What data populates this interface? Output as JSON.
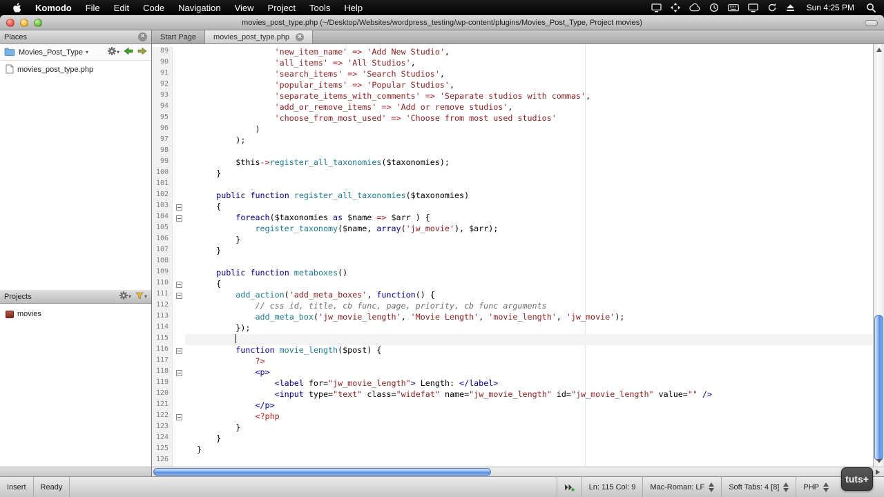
{
  "colors": {
    "pln": "#000000",
    "kw": "#00008b",
    "fn": "#1d7a94",
    "str": "#8f2121",
    "op": "#b02020",
    "com": "#6d6d6d",
    "ln": "#7f7f7f",
    "scrollbar": "#5b8ede"
  },
  "icons": {
    "dropdown": "▾",
    "close": "×"
  },
  "menubar": {
    "app": "Komodo",
    "menus": [
      "File",
      "Edit",
      "Code",
      "Navigation",
      "View",
      "Project",
      "Tools",
      "Help"
    ],
    "status_icons": [
      "screen-sharing",
      "move",
      "cloud",
      "time-machine",
      "keyboard",
      "display",
      "sync",
      "eject"
    ],
    "clock": "Sun 4:25 PM"
  },
  "titlebar": {
    "title": "movies_post_type.php (~/Desktop/Websites/wordpress_testing/wp-content/plugins/Movies_Post_Type, Project movies)"
  },
  "tabs": [
    {
      "label": "Start Page",
      "active": false
    },
    {
      "label": "movies_post_type.php",
      "active": true
    }
  ],
  "places": {
    "title": "Places",
    "folder": "Movies_Post_Type",
    "files": [
      "movies_post_type.php"
    ]
  },
  "projects": {
    "title": "Projects",
    "items": [
      "movies"
    ]
  },
  "statusbar": {
    "mode": "Insert",
    "status": "Ready",
    "position": "Ln: 115 Col: 9",
    "encoding": "Mac-Roman: LF",
    "soft_tabs": "Soft Tabs: 4 [8]",
    "language": "PHP"
  },
  "watermark": {
    "label": "tuts+"
  },
  "editor": {
    "lines": [
      {
        "n": 89,
        "indent": 16,
        "tokens": [
          [
            "str",
            "'new_item_name'"
          ],
          [
            "pln",
            " "
          ],
          [
            "op",
            "=>"
          ],
          [
            "pln",
            " "
          ],
          [
            "str",
            "'Add New Studio'"
          ],
          [
            "pln",
            ","
          ]
        ]
      },
      {
        "n": 90,
        "indent": 16,
        "tokens": [
          [
            "str",
            "'all_items'"
          ],
          [
            "pln",
            " "
          ],
          [
            "op",
            "=>"
          ],
          [
            "pln",
            " "
          ],
          [
            "str",
            "'All Studios'"
          ],
          [
            "pln",
            ","
          ]
        ]
      },
      {
        "n": 91,
        "indent": 16,
        "tokens": [
          [
            "str",
            "'search_items'"
          ],
          [
            "pln",
            " "
          ],
          [
            "op",
            "=>"
          ],
          [
            "pln",
            " "
          ],
          [
            "str",
            "'Search Studios'"
          ],
          [
            "pln",
            ","
          ]
        ]
      },
      {
        "n": 92,
        "indent": 16,
        "tokens": [
          [
            "str",
            "'popular_items'"
          ],
          [
            "pln",
            " "
          ],
          [
            "op",
            "=>"
          ],
          [
            "pln",
            " "
          ],
          [
            "str",
            "'Popular Studios'"
          ],
          [
            "pln",
            ","
          ]
        ]
      },
      {
        "n": 93,
        "indent": 16,
        "tokens": [
          [
            "str",
            "'separate_items_with_comments'"
          ],
          [
            "pln",
            " "
          ],
          [
            "op",
            "=>"
          ],
          [
            "pln",
            " "
          ],
          [
            "str",
            "'Separate studios with commas'"
          ],
          [
            "pln",
            ","
          ]
        ]
      },
      {
        "n": 94,
        "indent": 16,
        "tokens": [
          [
            "str",
            "'add_or_remove_items'"
          ],
          [
            "pln",
            " "
          ],
          [
            "op",
            "=>"
          ],
          [
            "pln",
            " "
          ],
          [
            "str",
            "'Add or remove studios'"
          ],
          [
            "pln",
            ","
          ]
        ]
      },
      {
        "n": 95,
        "indent": 16,
        "tokens": [
          [
            "str",
            "'choose_from_most_used'"
          ],
          [
            "pln",
            " "
          ],
          [
            "op",
            "=>"
          ],
          [
            "pln",
            " "
          ],
          [
            "str",
            "'Choose from most used studios'"
          ]
        ]
      },
      {
        "n": 96,
        "indent": 12,
        "tokens": [
          [
            "pln",
            ")"
          ]
        ]
      },
      {
        "n": 97,
        "indent": 8,
        "tokens": [
          [
            "pln",
            ");"
          ]
        ]
      },
      {
        "n": 98,
        "indent": 0,
        "tokens": []
      },
      {
        "n": 99,
        "indent": 8,
        "tokens": [
          [
            "pln",
            "$this"
          ],
          [
            "op",
            "->"
          ],
          [
            "fn",
            "register_all_taxonomies"
          ],
          [
            "pln",
            "($taxonomies);"
          ]
        ]
      },
      {
        "n": 100,
        "indent": 4,
        "tokens": [
          [
            "pln",
            "}"
          ]
        ]
      },
      {
        "n": 101,
        "indent": 0,
        "tokens": []
      },
      {
        "n": 102,
        "indent": 4,
        "tokens": [
          [
            "kw",
            "public"
          ],
          [
            "pln",
            " "
          ],
          [
            "kw",
            "function"
          ],
          [
            "pln",
            " "
          ],
          [
            "fn",
            "register_all_taxonomies"
          ],
          [
            "pln",
            "($taxonomies)"
          ]
        ]
      },
      {
        "n": 103,
        "indent": 4,
        "fold": true,
        "tokens": [
          [
            "pln",
            "{"
          ]
        ]
      },
      {
        "n": 104,
        "indent": 8,
        "fold": true,
        "tokens": [
          [
            "kw",
            "foreach"
          ],
          [
            "pln",
            "($taxonomies "
          ],
          [
            "kw",
            "as"
          ],
          [
            "pln",
            " $name "
          ],
          [
            "op",
            "=>"
          ],
          [
            "pln",
            " $arr ) {"
          ]
        ]
      },
      {
        "n": 105,
        "indent": 12,
        "tokens": [
          [
            "fn",
            "register_taxonomy"
          ],
          [
            "pln",
            "($name, "
          ],
          [
            "kw",
            "array"
          ],
          [
            "pln",
            "("
          ],
          [
            "str",
            "'jw_movie'"
          ],
          [
            "pln",
            "), $arr);"
          ]
        ]
      },
      {
        "n": 106,
        "indent": 8,
        "tokens": [
          [
            "pln",
            "}"
          ]
        ]
      },
      {
        "n": 107,
        "indent": 4,
        "tokens": [
          [
            "pln",
            "}"
          ]
        ]
      },
      {
        "n": 108,
        "indent": 0,
        "tokens": []
      },
      {
        "n": 109,
        "indent": 4,
        "tokens": [
          [
            "kw",
            "public"
          ],
          [
            "pln",
            " "
          ],
          [
            "kw",
            "function"
          ],
          [
            "pln",
            " "
          ],
          [
            "fn",
            "metaboxes"
          ],
          [
            "pln",
            "()"
          ]
        ]
      },
      {
        "n": 110,
        "indent": 4,
        "fold": true,
        "tokens": [
          [
            "pln",
            "{"
          ]
        ]
      },
      {
        "n": 111,
        "indent": 8,
        "fold": true,
        "tokens": [
          [
            "fn",
            "add_action"
          ],
          [
            "pln",
            "("
          ],
          [
            "str",
            "'add_meta_boxes'"
          ],
          [
            "pln",
            ", "
          ],
          [
            "kw",
            "function"
          ],
          [
            "pln",
            "() {"
          ]
        ]
      },
      {
        "n": 112,
        "indent": 12,
        "tokens": [
          [
            "com",
            "// css id, title, cb func, page, priority, cb func arguments"
          ]
        ]
      },
      {
        "n": 113,
        "indent": 12,
        "tokens": [
          [
            "fn",
            "add_meta_box"
          ],
          [
            "pln",
            "("
          ],
          [
            "str",
            "'jw_movie_length'"
          ],
          [
            "pln",
            ", "
          ],
          [
            "str",
            "'Movie Length'"
          ],
          [
            "pln",
            ", "
          ],
          [
            "str",
            "'movie_length'"
          ],
          [
            "pln",
            ", "
          ],
          [
            "str",
            "'jw_movie'"
          ],
          [
            "pln",
            ");"
          ]
        ]
      },
      {
        "n": 114,
        "indent": 8,
        "tokens": [
          [
            "pln",
            "});"
          ]
        ]
      },
      {
        "n": 115,
        "indent": 8,
        "current": true,
        "caret": true,
        "tokens": []
      },
      {
        "n": 116,
        "indent": 8,
        "fold": true,
        "tokens": [
          [
            "kw",
            "function"
          ],
          [
            "pln",
            " "
          ],
          [
            "fn",
            "movie_length"
          ],
          [
            "pln",
            "($post) {"
          ]
        ]
      },
      {
        "n": 117,
        "indent": 12,
        "tokens": [
          [
            "op",
            "?>"
          ]
        ]
      },
      {
        "n": 118,
        "indent": 12,
        "fold": true,
        "tokens": [
          [
            "kw",
            "<p>"
          ]
        ]
      },
      {
        "n": 119,
        "indent": 16,
        "tokens": [
          [
            "kw",
            "<label"
          ],
          [
            "pln",
            " for="
          ],
          [
            "str",
            "\"jw_movie_length\""
          ],
          [
            "kw",
            ">"
          ],
          [
            "pln",
            " Length: "
          ],
          [
            "kw",
            "</label>"
          ]
        ]
      },
      {
        "n": 120,
        "indent": 16,
        "tokens": [
          [
            "kw",
            "<input"
          ],
          [
            "pln",
            " type="
          ],
          [
            "str",
            "\"text\""
          ],
          [
            "pln",
            " class="
          ],
          [
            "str",
            "\"widefat\""
          ],
          [
            "pln",
            " name="
          ],
          [
            "str",
            "\"jw_movie_length\""
          ],
          [
            "pln",
            " id="
          ],
          [
            "str",
            "\"jw_movie_length\""
          ],
          [
            "pln",
            " value="
          ],
          [
            "str",
            "\"\""
          ],
          [
            "kw",
            " />"
          ]
        ]
      },
      {
        "n": 121,
        "indent": 12,
        "tokens": [
          [
            "kw",
            "</p>"
          ]
        ]
      },
      {
        "n": 122,
        "indent": 12,
        "fold": true,
        "tokens": [
          [
            "op",
            "<?php"
          ]
        ]
      },
      {
        "n": 123,
        "indent": 8,
        "tokens": [
          [
            "pln",
            "}"
          ]
        ]
      },
      {
        "n": 124,
        "indent": 4,
        "tokens": [
          [
            "pln",
            "}"
          ]
        ]
      },
      {
        "n": 125,
        "indent": 0,
        "tokens": [
          [
            "pln",
            "}"
          ]
        ]
      },
      {
        "n": 126,
        "indent": 0,
        "tokens": []
      }
    ]
  }
}
